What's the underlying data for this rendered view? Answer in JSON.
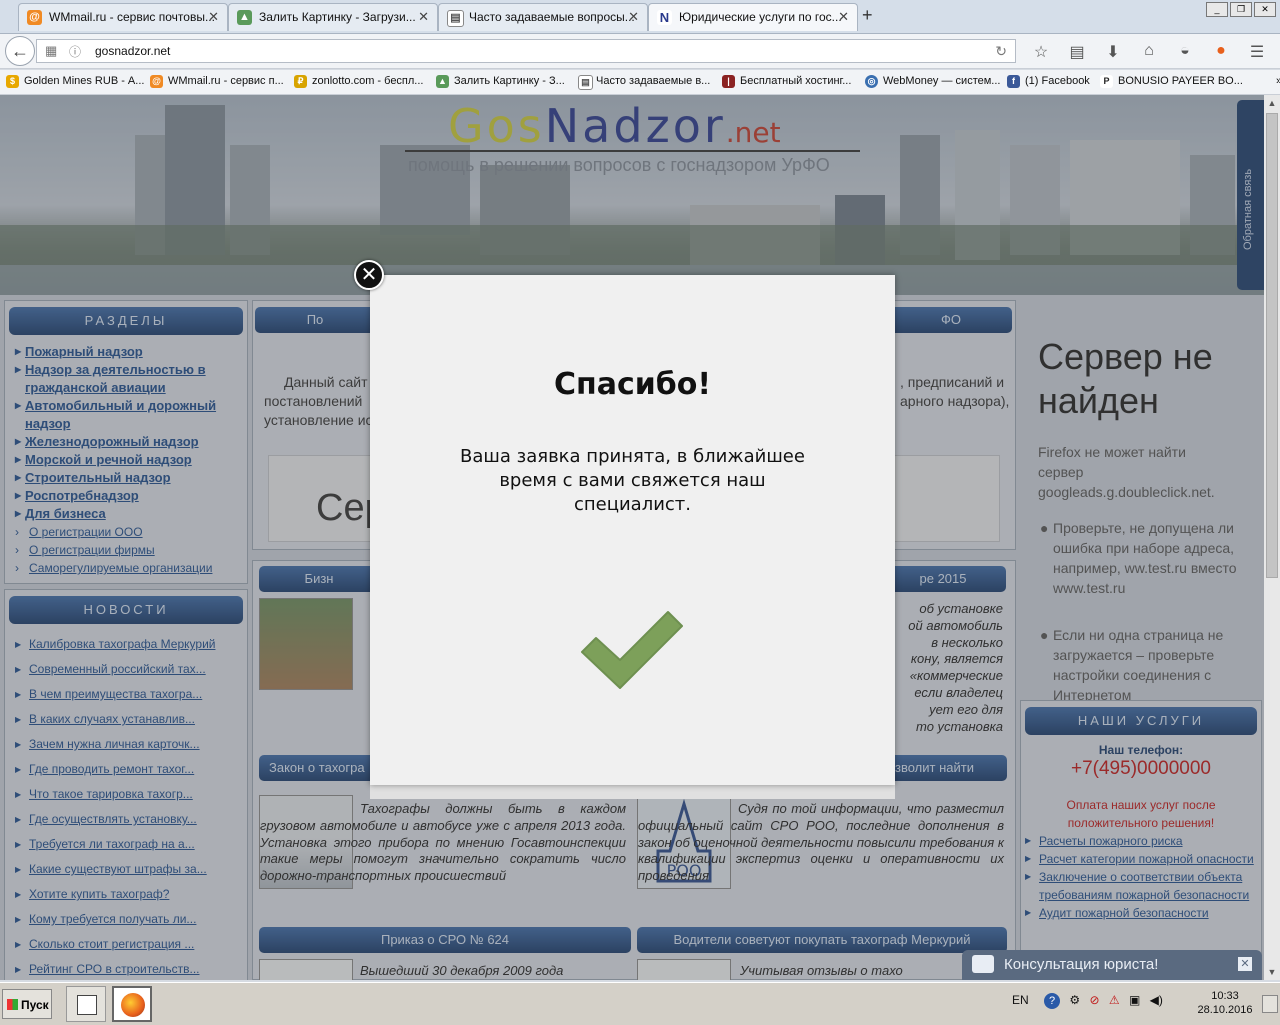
{
  "browser": {
    "tabs": [
      {
        "label": "WMmail.ru - сервис почтовы...",
        "icon": "wmmail-icon"
      },
      {
        "label": "Залить Картинку - Загрузи...",
        "icon": "image-upload-icon"
      },
      {
        "label": "Часто задаваемые вопросы...",
        "icon": "page-icon"
      },
      {
        "label": "Юридические услуги по гос...",
        "icon": "gosnadzor-icon",
        "active": true
      }
    ],
    "url": "gosnadzor.net",
    "bookmarks": [
      "Golden Mines RUB - А...",
      "WMmail.ru - сервис п...",
      "zonlotto.com - беспл...",
      "Залить Картинку - З...",
      "Часто задаваемые в...",
      "Бесплатный хостинг...",
      "WebMoney — систем...",
      "(1) Facebook",
      "BONUSIO PAYEER BO..."
    ]
  },
  "site": {
    "logo_gos": "Gos",
    "logo_nadzor": "Nadzor",
    "logo_net": ".net",
    "tagline": "помощь в решении вопросов с госнадзором УрФО",
    "feedback_tab": "Обратная связь",
    "sections_title": "РАЗДЕЛЫ",
    "sections": [
      "Пожарный надзор",
      "Надзор за деятельностью в гражданской авиации",
      "Автомобильный и дорожный надзор",
      "Железнодорожный надзор",
      "Морской и речной надзор",
      "Строительный надзор",
      "Роспотребнадзор",
      "Для бизнеса"
    ],
    "sub_sections": [
      "О регистрации ООО",
      "О регистрации фирмы",
      "Саморегулируемые организации"
    ],
    "news_title": "НОВОСТИ",
    "news": [
      "Калибровка тахографа Меркурий",
      "Современный российский тах...",
      "В чем преимущества тахогра...",
      "В каких случаях устанавлив...",
      "Зачем нужна личная карточк...",
      "Где проводить ремонт тахог...",
      "Что такое тарировка тахогр...",
      "Где осуществлять установку...",
      "Требуется ли тахограф на а...",
      "Какие существуют штрафы за...",
      "Хотите купить тахограф?",
      "Кому требуется получать ли...",
      "Сколько стоит регистрация ...",
      "Рейтинг СРО в строительств..."
    ],
    "mid_head1_left": "По",
    "mid_head1_right": "ФО",
    "intro_left1": "Данный сайт",
    "intro_right1": ", предписаний и",
    "intro_left2": "постановлений",
    "intro_right2": "арного надзора),",
    "intro_left3": "установление ис",
    "ad_text": "Сер",
    "article1_head_left": "Бизн",
    "article1_head_right": "ре 2015",
    "article2_head_left": "Закон о тахогра",
    "article2_head_right": "зволит найти",
    "article2_text": "Тахографы должны быть в каждом грузовом автомобиле и автобусе уже с апреля 2013 года. Установка этого прибора по мнению Госавтоинспекции такие меры помогут значительно сократить число дорожно-транспортных происшествий",
    "article3_text": "Судя по той информации, что разместил официальный сайт СРО РОО, последние дополнения в закон об оценочной деятельности повысили требования к квалификации экспертиз оценки и оперативности их проведения",
    "article4_head": "Приказ о СРО № 624",
    "article4_text": "Вышедший 30 декабря 2009 года",
    "article5_head": "Водители советуют покупать тахограф Меркурий",
    "article5_text": "Учитывая отзывы о тахо",
    "right_ital": [
      "об установке",
      "ой автомобиль",
      "в несколько",
      "кону, является",
      "«коммерческие",
      "если владелец",
      "ует его для",
      "то установка"
    ],
    "error_title": "Сервер не найден",
    "error_text": "Firefox не может найти сервер googleads.g.doubleclick.net.",
    "error_bullet1": "Проверьте, не допущена ли ошибка при наборе адреса, например, ww.test.ru вместо www.test.ru",
    "error_bullet2": "Если ни одна страница не загружается – проверьте настройки соединения с Интернетом",
    "services_title": "НАШИ УСЛУГИ",
    "phone_label": "Наш телефон:",
    "phone": "+7(495)0000000",
    "payment_note": "Оплата наших услуг после положительного решения!",
    "services": [
      "Расчеты пожарного риска",
      "Расчет категории пожарной опасности",
      "Заключение о соответствии объекта требованиям пожарной безопасности",
      "Аудит пожарной безопасности"
    ],
    "chat_label": "Консультация юриста!"
  },
  "modal": {
    "title": "Спасибо!",
    "message": "Ваша заявка принята, в ближайшее время с вами свяжется наш специалист.",
    "check_color": "#7da05a"
  },
  "taskbar": {
    "start_label": "Пуск",
    "lang": "EN",
    "time": "10:33",
    "date": "28.10.2016"
  }
}
